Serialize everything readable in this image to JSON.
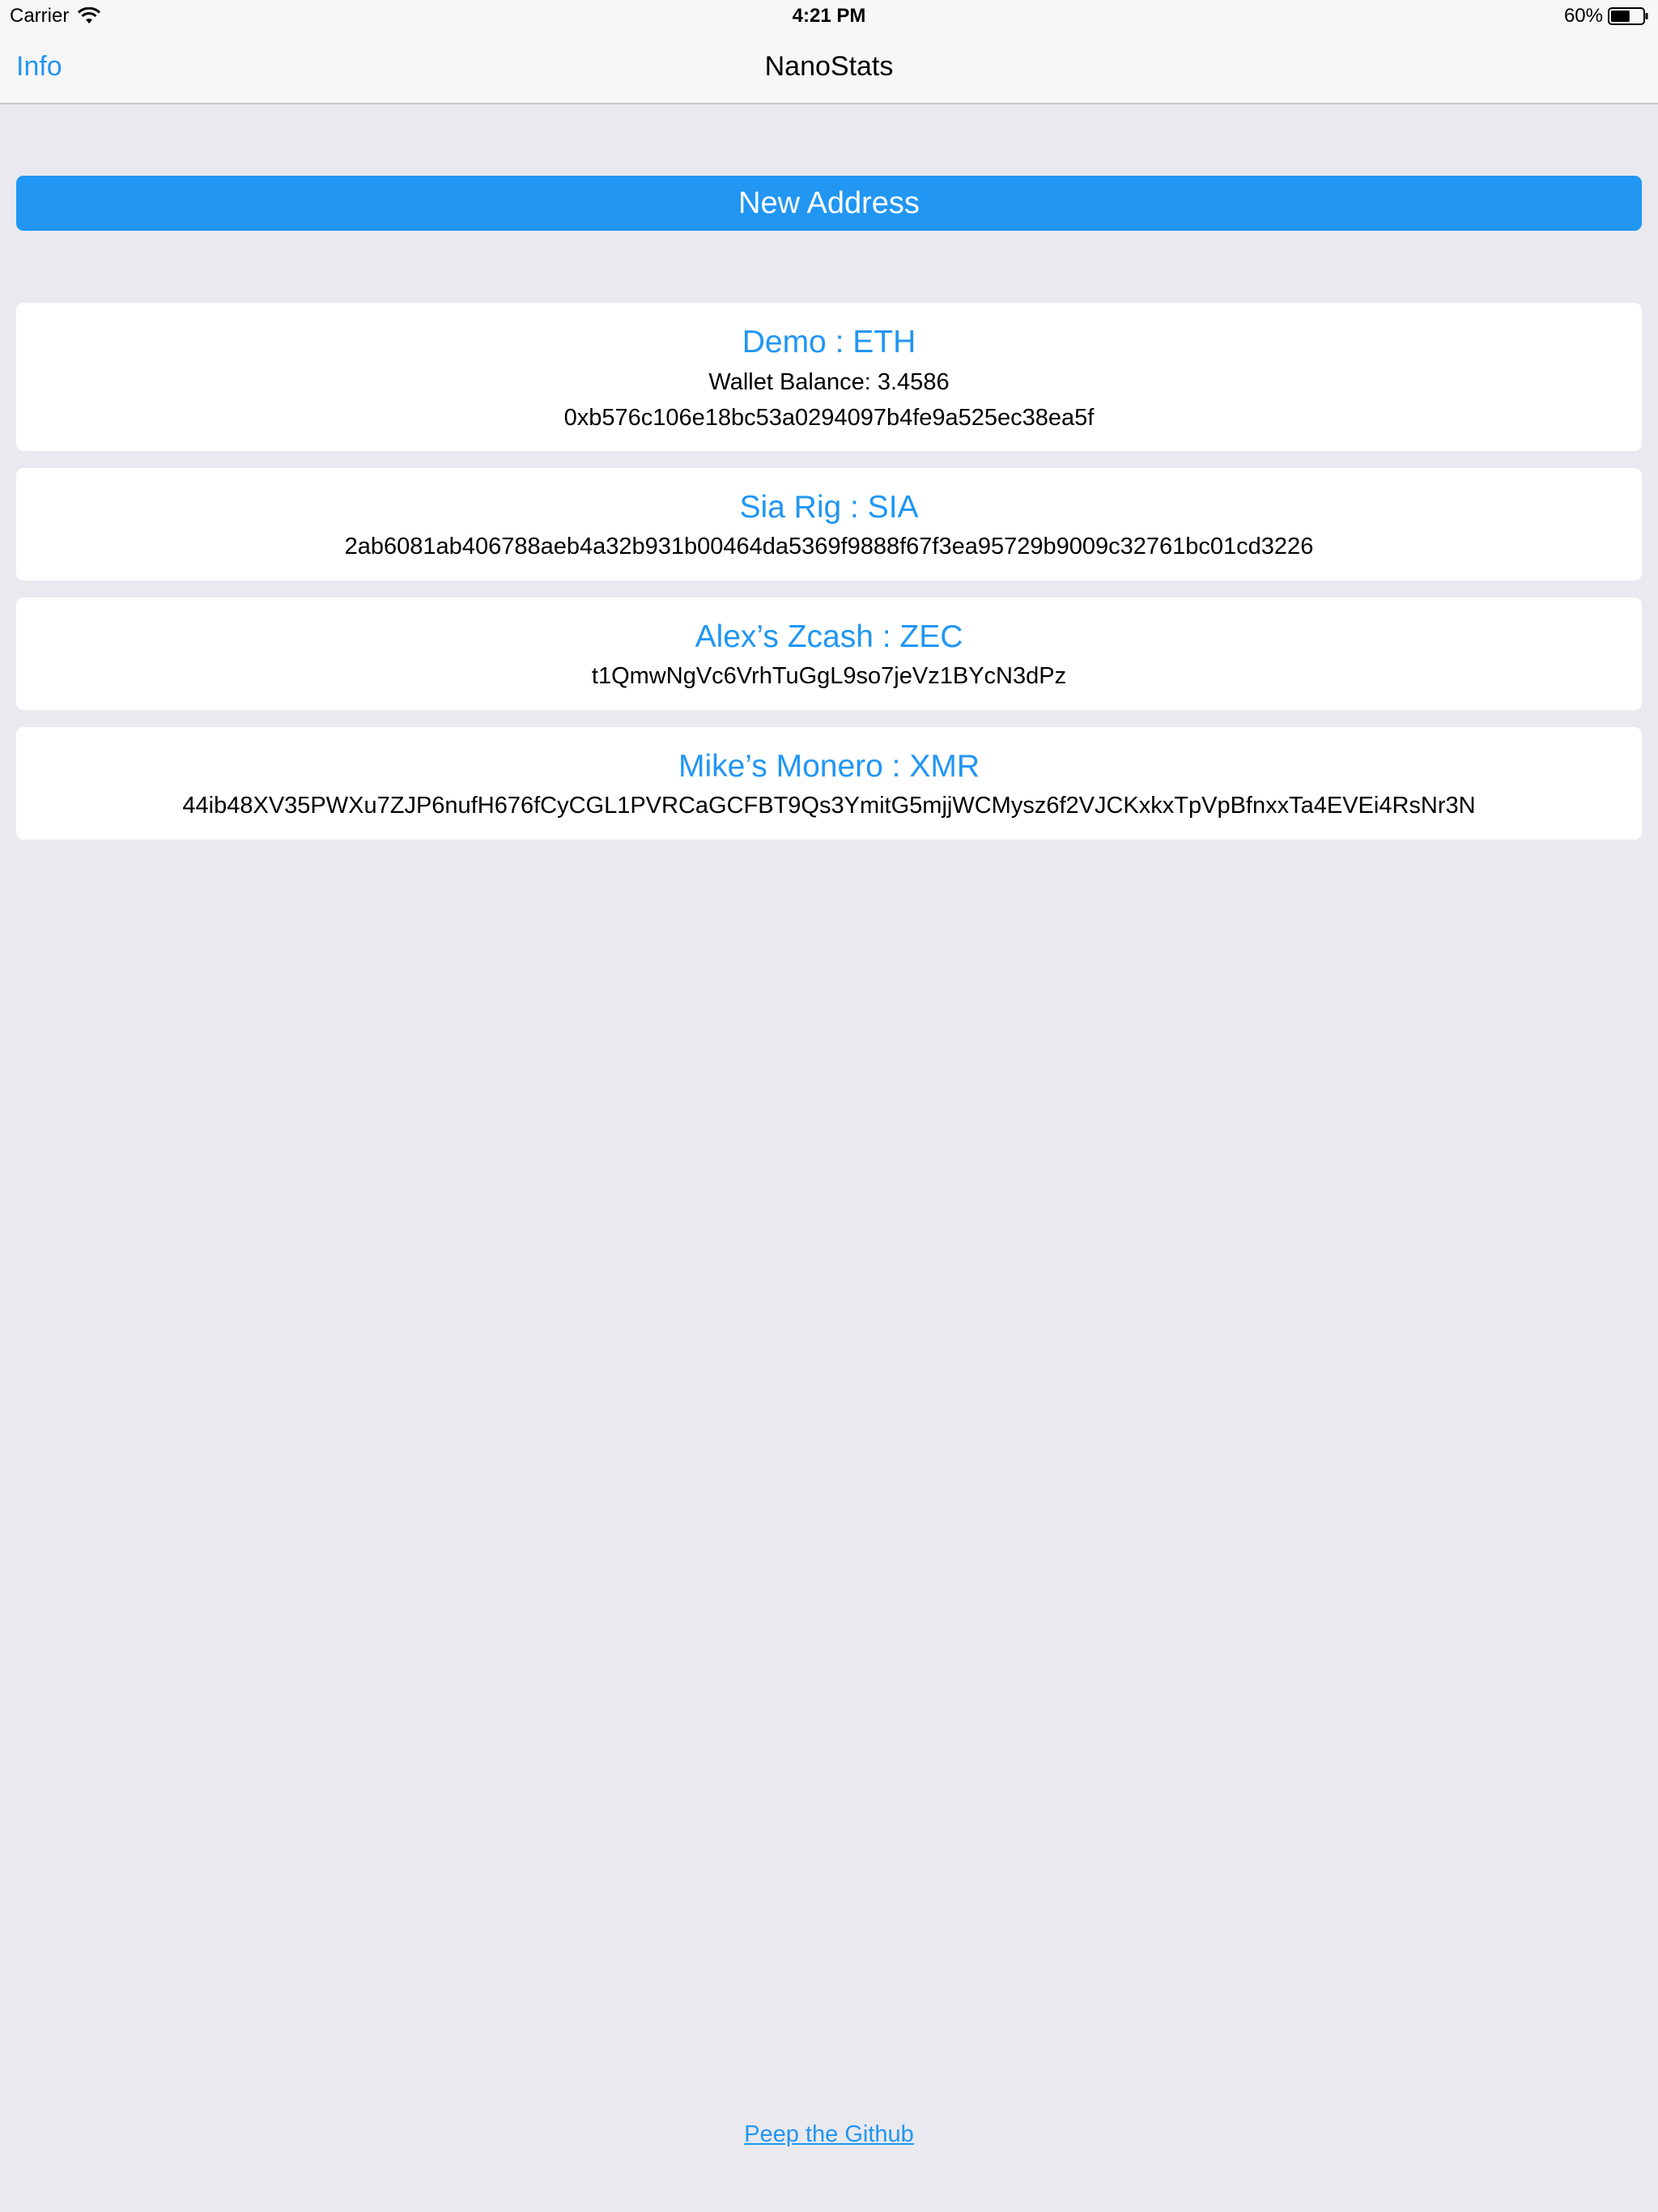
{
  "status_bar": {
    "carrier": "Carrier",
    "time": "4:21 PM",
    "battery": "60%",
    "battery_level": 0.6
  },
  "nav": {
    "left_button": "Info",
    "title": "NanoStats"
  },
  "new_address_button": "New Address",
  "wallets": [
    {
      "title": "Demo : ETH",
      "balance": "Wallet Balance: 3.4586",
      "address": "0xb576c106e18bc53a0294097b4fe9a525ec38ea5f"
    },
    {
      "title": "Sia Rig : SIA",
      "address": "2ab6081ab406788aeb4a32b931b00464da5369f9888f67f3ea95729b9009c32761bc01cd3226"
    },
    {
      "title": "Alex’s Zcash : ZEC",
      "address": "t1QmwNgVc6VrhTuGgL9so7jeVz1BYcN3dPz"
    },
    {
      "title": "Mike’s Monero : XMR",
      "address": "44ib48XV35PWXu7ZJP6nufH676fCyCGL1PVRCaGCFBT9Qs3YmitG5mjjWCMysz6f2VJCKxkxTpVpBfnxxTa4EVEi4RsNr3N"
    }
  ],
  "footer_link": "Peep the Github",
  "colors": {
    "accent": "#2196f3",
    "background": "#e9e9ef",
    "bar": "#f7f7f7",
    "card": "#ffffff"
  },
  "icons": {
    "wifi": "wifi-icon",
    "battery": "battery-icon"
  }
}
